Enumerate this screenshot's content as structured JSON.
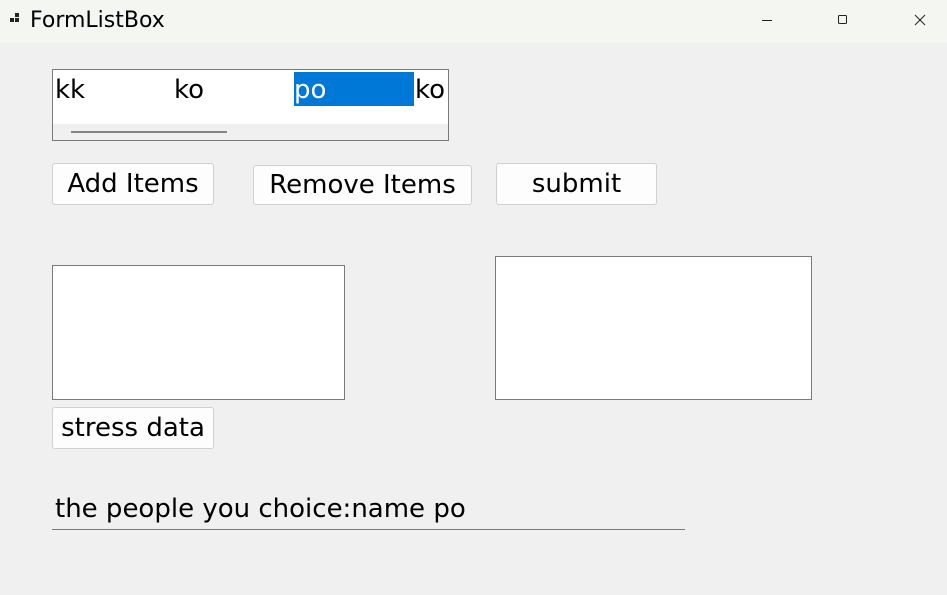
{
  "window": {
    "title": "FormListBox",
    "icon": "app-form-icon",
    "controls": [
      "minimize-icon",
      "maximize-icon",
      "close-icon"
    ]
  },
  "listbox": {
    "items": [
      "kk",
      "ko",
      "po",
      "ko"
    ],
    "selected_index": 2,
    "selection_color": "#0078d7"
  },
  "buttons": {
    "add_label": "Add Items",
    "remove_label": "Remove Items",
    "submit_label": "submit",
    "stress_label": "stress data"
  },
  "result": {
    "text": "the people you choice:name po"
  }
}
